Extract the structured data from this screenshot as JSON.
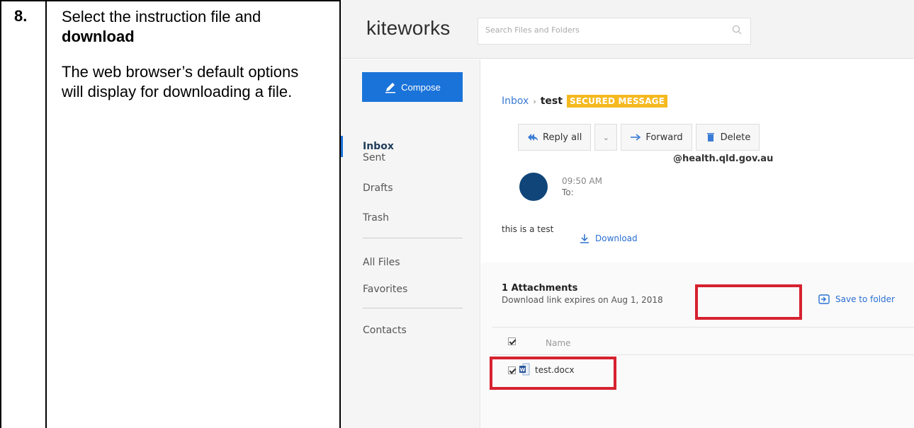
{
  "doc": {
    "step_number": "8.",
    "instruction_part1": "Select the instruction file and ",
    "instruction_bold": "download",
    "description": "The web browser’s default options will display for downloading a file."
  },
  "app": {
    "logo": "kiteworks",
    "search_placeholder": "Search Files and Folders",
    "compose_label": "Compose",
    "nav": {
      "inbox": "Inbox",
      "sent": "Sent",
      "drafts": "Drafts",
      "trash": "Trash",
      "all_files": "All Files",
      "favorites": "Favorites",
      "contacts": "Contacts"
    },
    "breadcrumb": {
      "inbox": "Inbox",
      "separator": "›",
      "subject": "test",
      "badge": "SECURED MESSAGE"
    },
    "toolbar": {
      "reply_all": "Reply all",
      "caret": "⌄",
      "forward": "Forward",
      "delete": "Delete"
    },
    "message": {
      "sender": "@health.qld.gov.au",
      "time": "09:50 AM",
      "to": "To:",
      "body": "this is a test"
    },
    "attachments": {
      "count_label": "1 Attachments",
      "expiry": "Download link expires on Aug 1, 2018",
      "download_label": "Download",
      "save_label": "Save to folder",
      "column_name": "Name",
      "files": [
        "test.docx"
      ]
    }
  },
  "colors": {
    "compose": "#1a73d9",
    "avatar": "#0f4579",
    "badge": "#f5b920",
    "highlight": "#d6212f",
    "link": "#2a6fd2"
  },
  "icons": [
    "pencil-icon",
    "search-icon",
    "reply-all-icon",
    "forward-arrow-icon",
    "trash-icon",
    "download-icon",
    "save-to-folder-icon",
    "word-document-icon",
    "checkbox-icon"
  ]
}
